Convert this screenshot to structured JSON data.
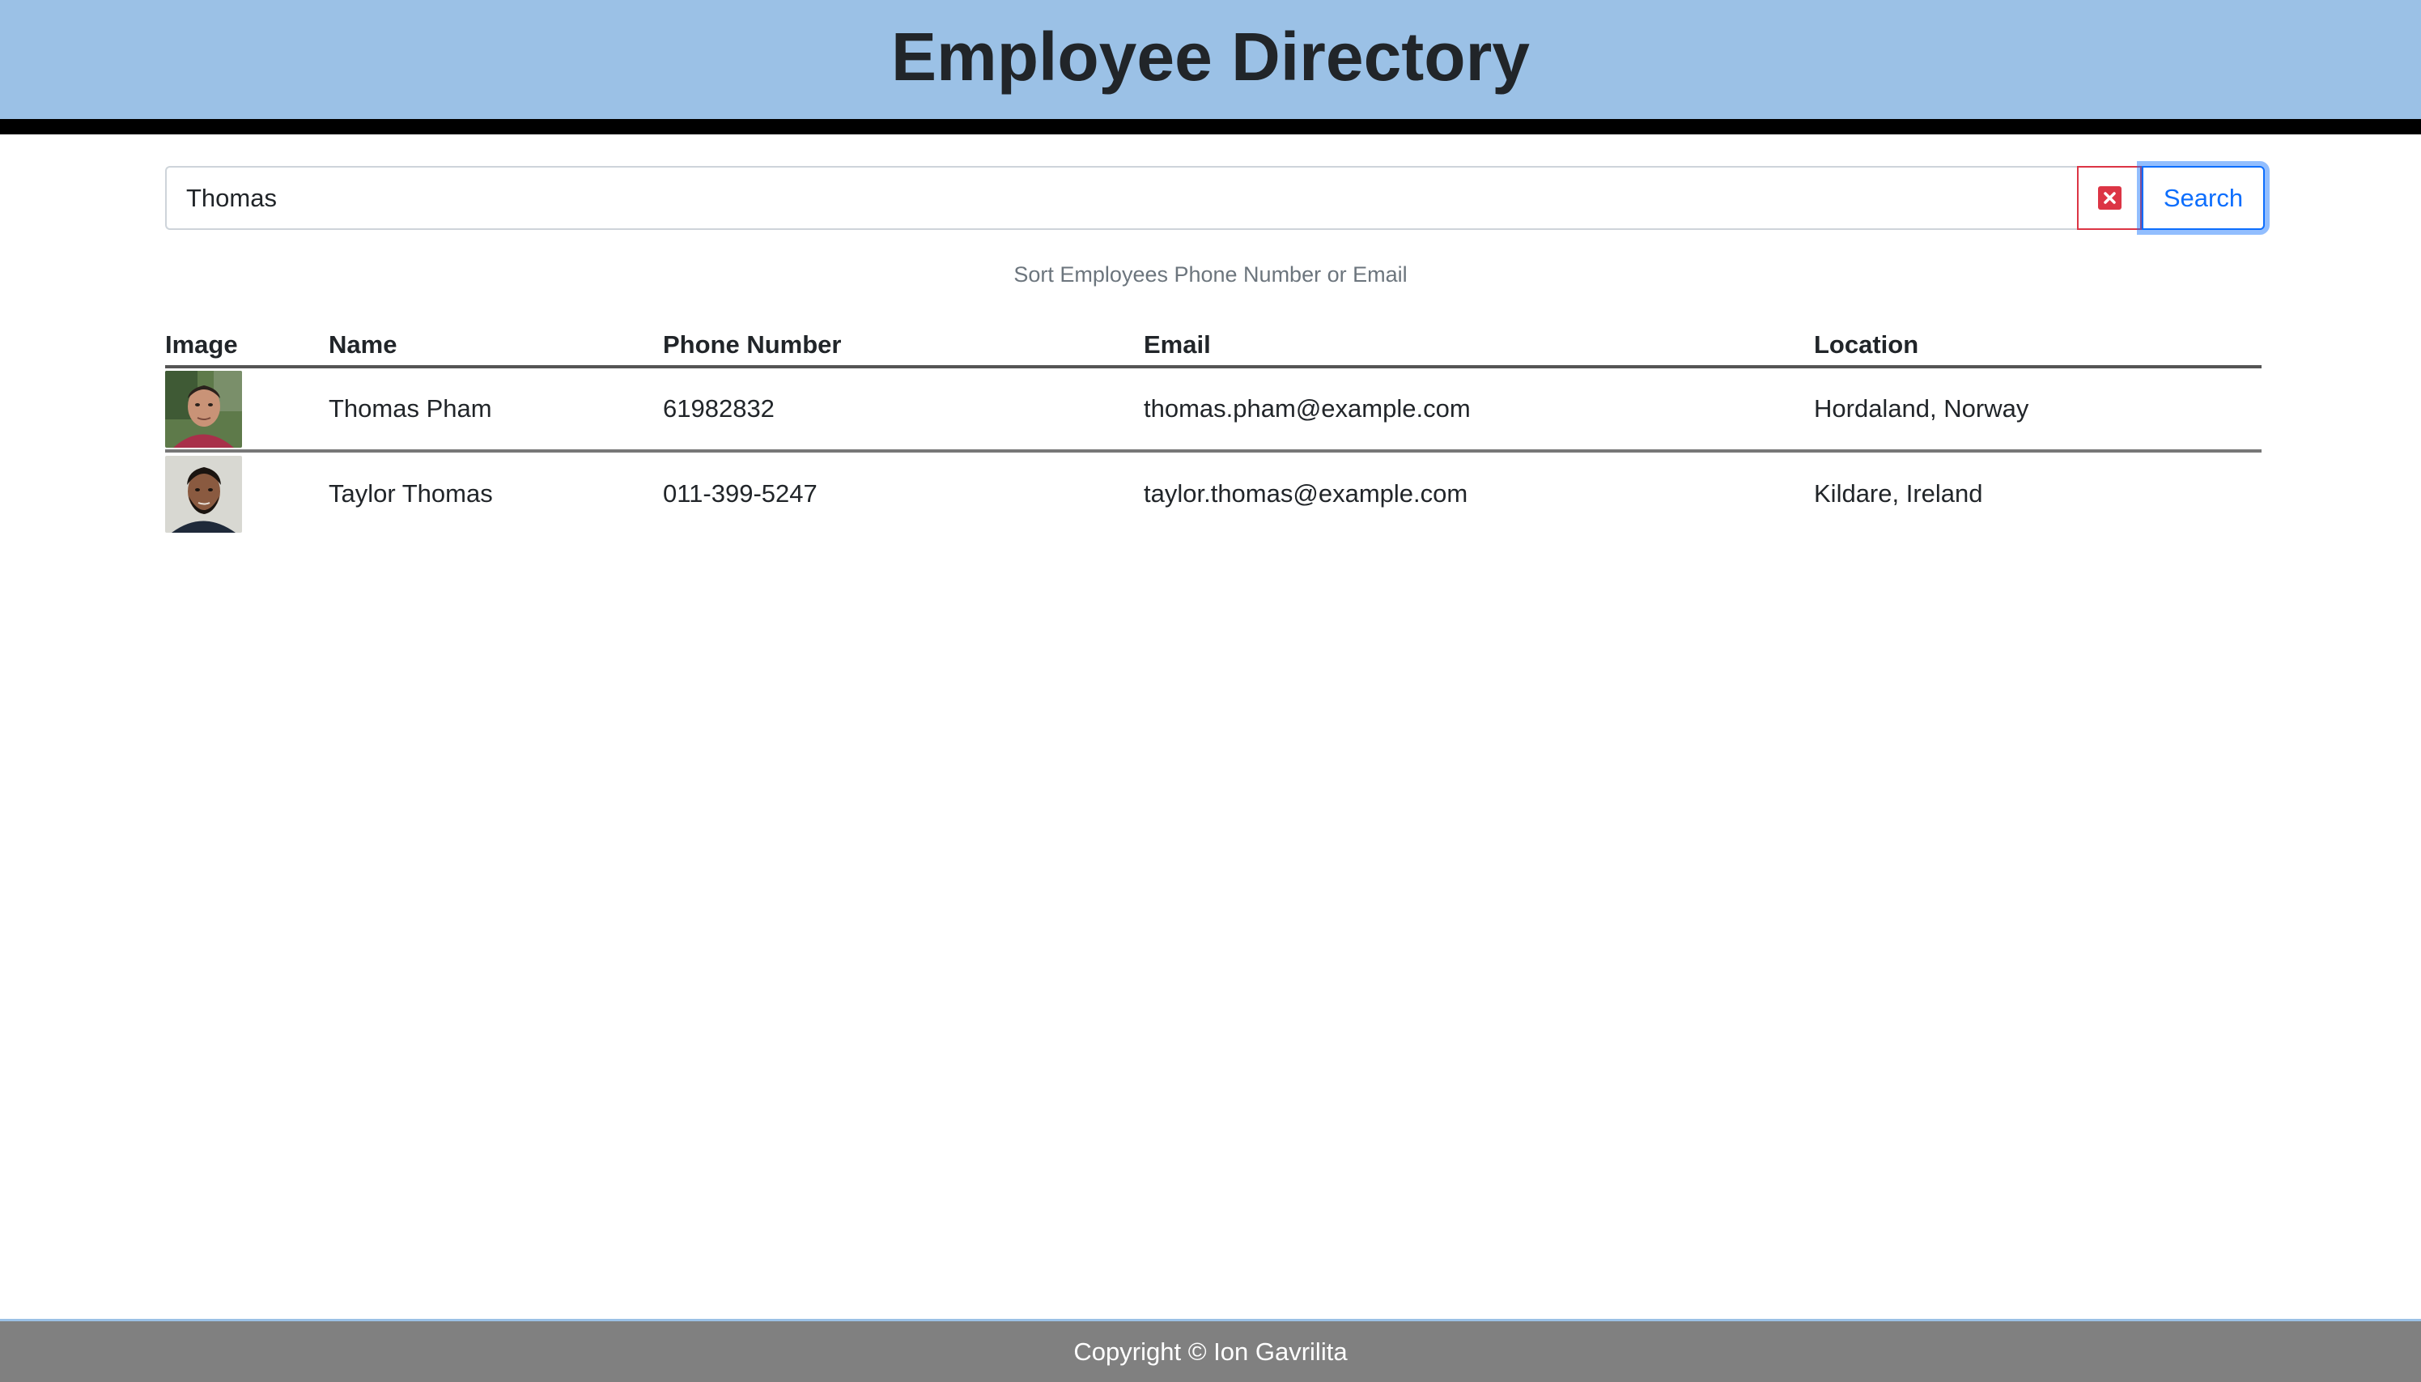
{
  "header": {
    "title": "Employee Directory"
  },
  "search": {
    "value": "Thomas",
    "clear_icon": "close-icon",
    "button_label": "Search"
  },
  "hint": "Sort Employees Phone Number or Email",
  "table": {
    "columns": [
      "Image",
      "Name",
      "Phone Number",
      "Email",
      "Location"
    ],
    "rows": [
      {
        "image": "employee-photo",
        "name": "Thomas Pham",
        "phone": "61982832",
        "email": "thomas.pham@example.com",
        "location": "Hordaland, Norway"
      },
      {
        "image": "employee-photo",
        "name": "Taylor Thomas",
        "phone": "011-399-5247",
        "email": "taylor.thomas@example.com",
        "location": "Kildare, Ireland"
      }
    ]
  },
  "footer": {
    "text": "Copyright © Ion Gavrilita"
  },
  "colors": {
    "header_bg": "#9bc1e6",
    "footer_bg": "#808080",
    "primary": "#0d6efd",
    "danger": "#dc3545"
  }
}
